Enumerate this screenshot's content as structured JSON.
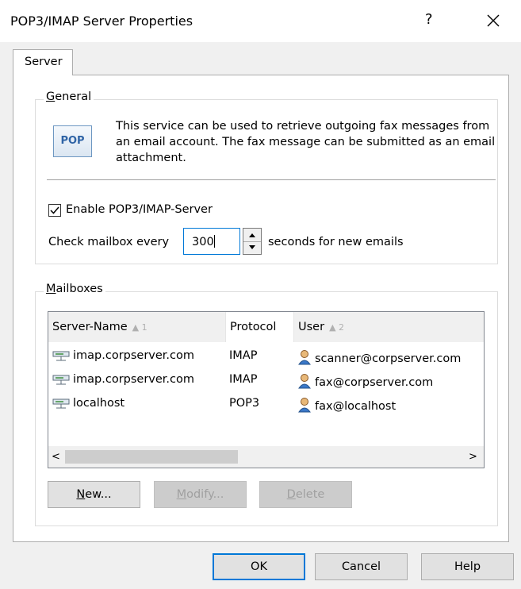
{
  "window": {
    "title": "POP3/IMAP Server Properties",
    "help_glyph": "?",
    "close_glyph": "close-icon"
  },
  "tab": {
    "label": "Server"
  },
  "general": {
    "legend": "General",
    "legend_accel": "G",
    "legend_rest": "eneral",
    "icon_text": "POP",
    "description": "This service can be used to retrieve outgoing fax messages from an email account. The fax message can be submitted as an email attachment.",
    "enable_label": "Enable POP3/IMAP-Server",
    "enable_checked": true,
    "interval_prefix": "Check mailbox every",
    "interval_value": "300",
    "interval_suffix": "seconds for new emails"
  },
  "mailboxes": {
    "legend_accel": "M",
    "legend_rest": "ailboxes",
    "columns": [
      {
        "label": "Server-Name",
        "sort": "1"
      },
      {
        "label": "Protocol",
        "sort": ""
      },
      {
        "label": "User",
        "sort": "2"
      }
    ],
    "rows": [
      {
        "server": "imap.corpserver.com",
        "protocol": "IMAP",
        "user": "scanner@corpserver.com"
      },
      {
        "server": "imap.corpserver.com",
        "protocol": "IMAP",
        "user": "fax@corpserver.com"
      },
      {
        "server": "localhost",
        "protocol": "POP3",
        "user": "fax@localhost"
      }
    ],
    "scroll_left": "<",
    "scroll_right": ">",
    "buttons": {
      "new_accel": "N",
      "new_rest": "ew...",
      "modify_accel": "M",
      "modify_rest": "odify...",
      "delete_accel": "D",
      "delete_rest": "elete"
    }
  },
  "footer": {
    "ok": "OK",
    "cancel": "Cancel",
    "help": "Help"
  },
  "colors": {
    "focus_blue": "#0078d7",
    "dialog_bg": "#f0f0f0"
  }
}
